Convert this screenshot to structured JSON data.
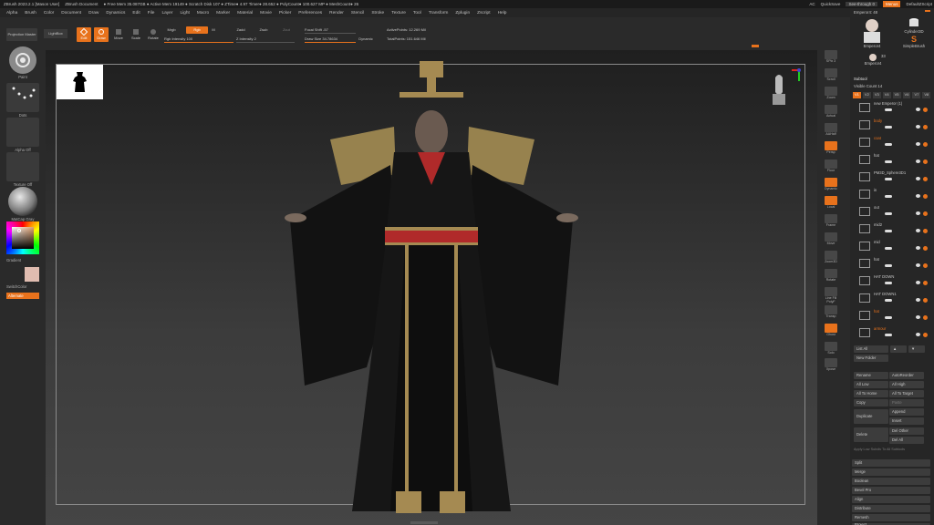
{
  "titlebar": {
    "app": "ZBrush 2023.2.1 [Mason User]",
    "document": "ZBrush Document",
    "stats": "● Free Mem 35.087GB ● Active Mem 19149 ● Scratch Disk 107 ● ZTime● 4.97 Timer● 28.652 ● PolyCount● 100.627 MP ● MeshCount● 26",
    "ac": "AC",
    "quicksave": "QuickSave",
    "seethrough": "See-through 0",
    "menus": "Menus",
    "defaultzscript": "DefaultZScript"
  },
  "menubar": [
    "Alpha",
    "Brush",
    "Color",
    "Document",
    "Draw",
    "Dynamics",
    "Edit",
    "File",
    "Layer",
    "Light",
    "Macro",
    "Marker",
    "Material",
    "Movie",
    "Picker",
    "Preferences",
    "Render",
    "Stencil",
    "Stroke",
    "Texture",
    "Tool",
    "Transform",
    "Zplugin",
    "Zscript",
    "Help"
  ],
  "toolbar": {
    "projection": "Projection Master",
    "lightbox": "LightBox",
    "edit": "Edit",
    "draw": "Draw",
    "move": "Move",
    "scale": "Scale",
    "rotate": "Rotate",
    "mrgb": "Mrgb",
    "rgb": "Rgb",
    "m": "M",
    "rgb_intensity": "Rgb Intensity 100",
    "zadd": "Zadd",
    "zsub": "Zsub",
    "zcut": "Zcut",
    "z_intensity": "Z Intensity 2",
    "focal_shift": "Focal Shift -57",
    "draw_size": "Draw Size 34.78634",
    "dynamic": "Dynamic",
    "active_points": "ActivePoints: 12.269 Mil",
    "total_points": "TotalPoints: 151.646 Mil"
  },
  "leftshelf": {
    "brush": "Paint",
    "stroke": "Dots",
    "alpha": "Alpha Off",
    "texture": "Texture Off",
    "material": "MatCap Gray",
    "gradient": "Gradient",
    "switchcolor": "SwitchColor",
    "alternate": "Alternate"
  },
  "rightshelf": [
    "SPix 3",
    "Scroll",
    "Zoom",
    "Actual",
    "AAHalf",
    "Persp",
    "Floor",
    "Dynamic",
    "Local",
    "Frame",
    "Move",
    "Zoom3D",
    "Rotate",
    "Line Fill PolyF",
    "Transp",
    "Ghost",
    "Solo",
    "Xpose"
  ],
  "panel": {
    "tool_name": "Emperor4: 48",
    "thumb1": "Emperor4",
    "thumb2": "Cylinder3D",
    "thumb3": "SimpleBrush",
    "thumb4": "Emperor4",
    "thumb4_count": "33",
    "subtool_title": "Subtool",
    "visible_count": "Visible Count 14",
    "v_tabs": [
      "V1",
      "V2",
      "V3",
      "V4",
      "V5",
      "V6",
      "V7",
      "V8"
    ],
    "items": [
      {
        "name": "new Emperor (1)",
        "orange": false
      },
      {
        "name": "body",
        "orange": true
      },
      {
        "name": "coat",
        "orange": true
      },
      {
        "name": "hat",
        "orange": false
      },
      {
        "name": "PM3D_Sphere3D1",
        "orange": false
      },
      {
        "name": "in",
        "orange": false
      },
      {
        "name": "out",
        "orange": false
      },
      {
        "name": "mid2",
        "orange": false
      },
      {
        "name": "mid",
        "orange": false
      },
      {
        "name": "hat",
        "orange": false
      },
      {
        "name": "HAT DOWN",
        "orange": false
      },
      {
        "name": "HAT DOWN1",
        "orange": false
      },
      {
        "name": "hat",
        "orange": true
      },
      {
        "name": "armour",
        "orange": true
      }
    ],
    "list_all": "List All",
    "new_folder": "New Folder",
    "rename": "Rename",
    "autoreorder": "AutoReorder",
    "all_low": "All Low",
    "all_high": "All High",
    "all_to_home": "All To Home",
    "all_to_target": "All To Target",
    "copy": "Copy",
    "paste": "Paste",
    "duplicate": "Duplicate",
    "append": "Append",
    "insert": "Insert",
    "delete": "Delete",
    "del_other": "Del Other",
    "del_all": "Del All",
    "apply_low": "Apply Low Subdiv To All Subtools",
    "split": "Split",
    "merge": "Merge",
    "boolean": "Boolean",
    "bevel_pro": "Bevel Pro",
    "align": "Align",
    "distribute": "Distribute",
    "remesh": "Remesh",
    "project": "Project"
  },
  "colors": {
    "accent": "#e8721c",
    "bg": "#2a2a2a",
    "swatch": "#e0bcb0"
  }
}
